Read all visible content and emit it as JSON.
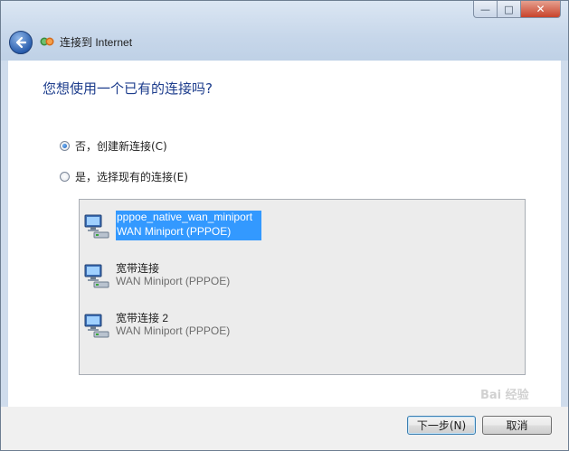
{
  "window": {
    "title": "连接到 Internet",
    "caption_buttons": {
      "minimize": "—",
      "maximize": "□",
      "close": "✕"
    }
  },
  "heading": "您想使用一个已有的连接吗?",
  "options": [
    {
      "label": "否，创建新连接(C)",
      "checked": true
    },
    {
      "label": "是，选择现有的连接(E)",
      "checked": false
    }
  ],
  "connections": [
    {
      "name": "pppoe_native_wan_miniport",
      "device": "WAN Miniport (PPPOE)",
      "selected": true,
      "icon": "network-connection-icon"
    },
    {
      "name": "宽带连接",
      "device": "WAN Miniport (PPPOE)",
      "selected": false,
      "icon": "network-connection-icon"
    },
    {
      "name": "宽带连接 2",
      "device": "WAN Miniport (PPPOE)",
      "selected": false,
      "icon": "network-connection-icon"
    }
  ],
  "buttons": {
    "next": "下一步(N)",
    "cancel": "取消"
  },
  "watermark": "Bai 经验",
  "colors": {
    "heading": "#1c3c8c",
    "selection": "#3399ff"
  }
}
